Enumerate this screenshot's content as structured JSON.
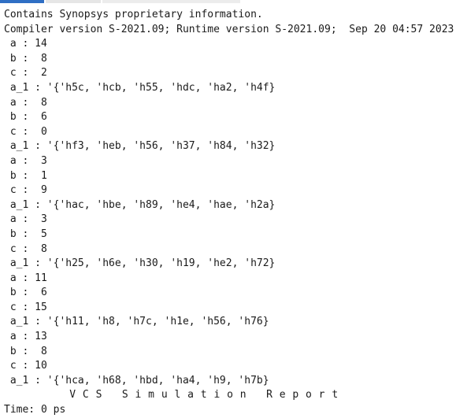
{
  "header": [
    "Contains Synopsys proprietary information.",
    "Compiler version S-2021.09; Runtime version S-2021.09;  Sep 20 04:57 2023"
  ],
  "output": [
    " a : 14",
    " b :  8",
    " c :  2",
    " a_1 : '{'h5c, 'hcb, 'h55, 'hdc, 'ha2, 'h4f}",
    " a :  8",
    " b :  6",
    " c :  0",
    " a_1 : '{'hf3, 'heb, 'h56, 'h37, 'h84, 'h32}",
    " a :  3",
    " b :  1",
    " c :  9",
    " a_1 : '{'hac, 'hbe, 'h89, 'he4, 'hae, 'h2a}",
    " a :  3",
    " b :  5",
    " c :  8",
    " a_1 : '{'h25, 'h6e, 'h30, 'h19, 'he2, 'h72}",
    " a : 11",
    " b :  6",
    " c : 15",
    " a_1 : '{'h11, 'h8, 'h7c, 'h1e, 'h56, 'h76}",
    " a : 13",
    " b :  8",
    " c : 10",
    " a_1 : '{'hca, 'h68, 'hbd, 'ha4, 'h9, 'h7b}"
  ],
  "report_title": "          V C S   S i m u l a t i o n   R e p o r t",
  "time_line": "Time: 0 ps"
}
